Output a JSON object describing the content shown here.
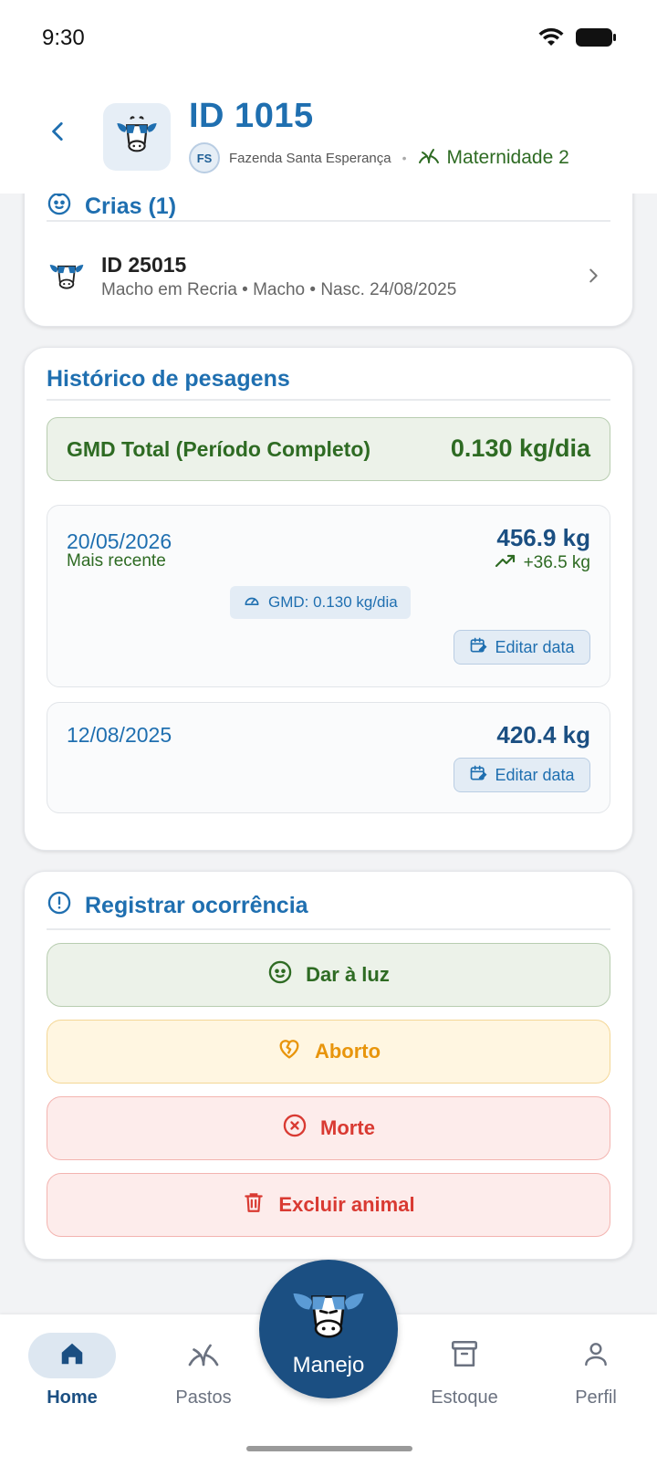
{
  "status_bar": {
    "time": "9:30"
  },
  "header": {
    "title": "ID 1015",
    "farm_initials": "FS",
    "farm_name": "Fazenda Santa Esperança",
    "separator": "•",
    "pasture": "Maternidade 2"
  },
  "crias": {
    "title": "Crias (1)",
    "items": [
      {
        "id": "ID 25015",
        "description": "Macho em Recria • Macho • Nasc. 24/08/2025"
      }
    ]
  },
  "historico": {
    "title": "Histórico de pesagens",
    "gmd_total_label": "GMD Total (Período Completo)",
    "gmd_total_value": "0.130 kg/dia",
    "entries": [
      {
        "date": "20/05/2026",
        "subtitle": "Mais recente",
        "weight": "456.9 kg",
        "delta": "+36.5 kg",
        "gmd": "GMD: 0.130 kg/dia",
        "edit_label": "Editar data"
      },
      {
        "date": "12/08/2025",
        "weight": "420.4 kg",
        "edit_label": "Editar data"
      }
    ]
  },
  "ocorrencia": {
    "title": "Registrar ocorrência",
    "buttons": {
      "dar_a_luz": "Dar à luz",
      "aborto": "Aborto",
      "morte": "Morte",
      "excluir": "Excluir animal"
    }
  },
  "nav": {
    "home": "Home",
    "pastos": "Pastos",
    "manejo": "Manejo",
    "estoque": "Estoque",
    "perfil": "Perfil"
  },
  "colors": {
    "primary": "#1f6fb0",
    "dark_primary": "#1b4f82",
    "green": "#2e6b23",
    "orange": "#e8950c",
    "red": "#d93a32"
  }
}
